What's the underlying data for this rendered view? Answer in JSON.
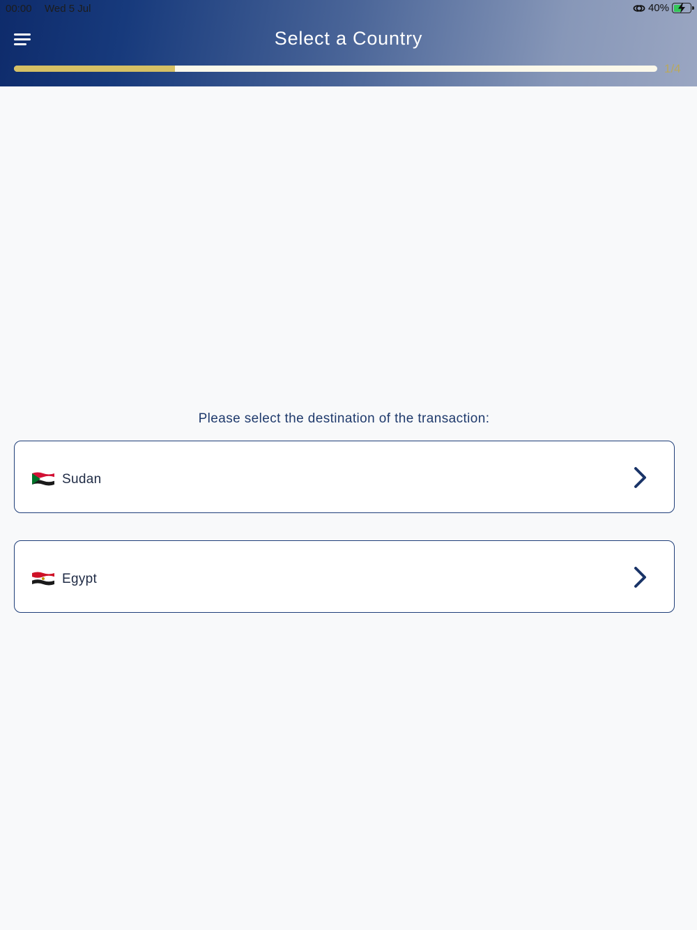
{
  "status_bar": {
    "time": "00:00",
    "date": "Wed 5 Jul",
    "battery": "40%"
  },
  "header": {
    "title": "Select a Country",
    "progress_text": "1/4",
    "progress_fraction": 0.25,
    "accent_color": "#d6c064",
    "brand_color": "#0e2b6b"
  },
  "main": {
    "prompt": "Please select the destination of the transaction:",
    "countries": [
      {
        "name": "Sudan",
        "flag_icon": "sudan-flag-icon"
      },
      {
        "name": "Egypt",
        "flag_icon": "egypt-flag-icon"
      }
    ]
  }
}
